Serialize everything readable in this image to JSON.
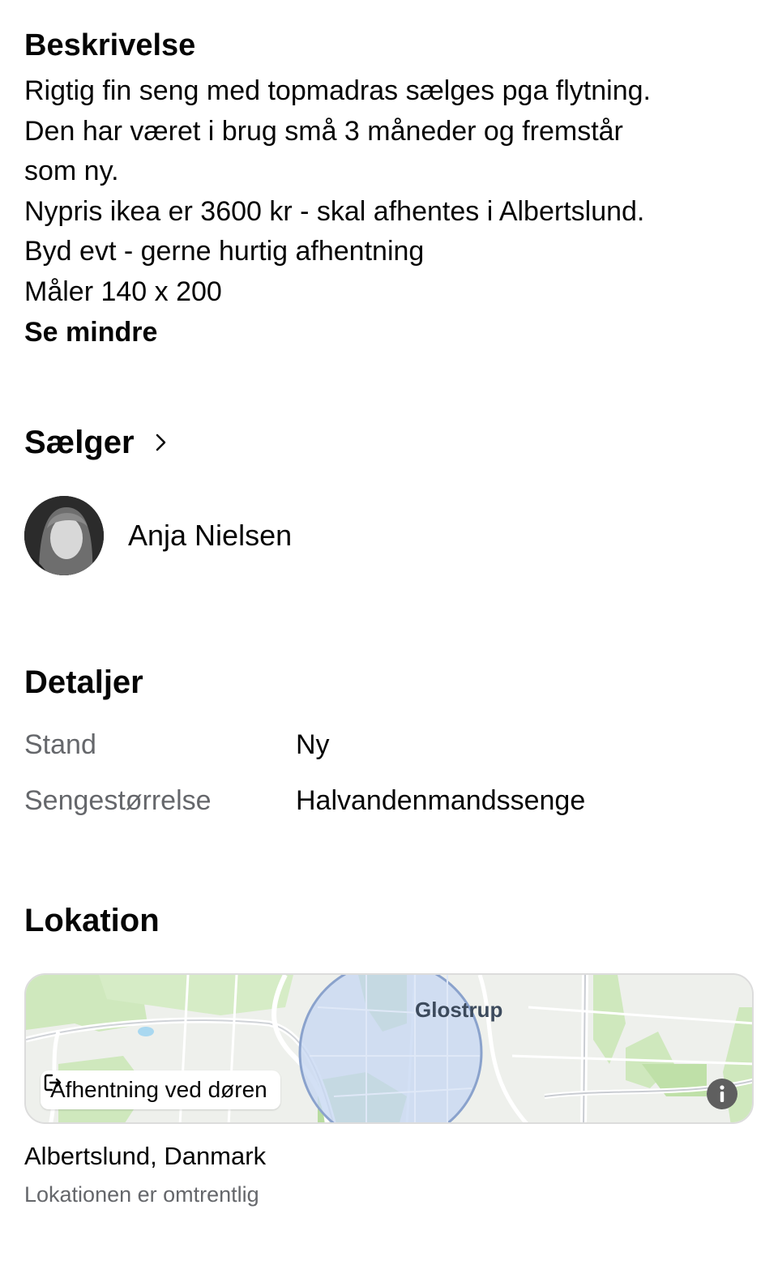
{
  "description": {
    "title": "Beskrivelse",
    "lines": [
      "Rigtig fin seng med topmadras sælges pga flytning.",
      "Den har været i brug små 3 måneder og fremstår",
      "som ny.",
      "Nypris ikea er 3600 kr - skal afhentes i Albertslund.",
      "Byd evt - gerne hurtig afhentning",
      "Måler 140 x 200"
    ],
    "see_less": "Se mindre"
  },
  "seller": {
    "title": "Sælger",
    "chevron_icon": "chevron-right-icon",
    "name": "Anja Nielsen",
    "avatar_icon": "profile-photo"
  },
  "details": {
    "title": "Detaljer",
    "rows": [
      {
        "key": "Stand",
        "value": "Ny"
      },
      {
        "key": "Sengestørrelse",
        "value": "Halvandenmandssenge"
      }
    ]
  },
  "location": {
    "title": "Lokation",
    "map_label": "Glostrup",
    "pickup_chip": "Afhentning ved døren",
    "pickup_icon": "door-exit-icon",
    "info_icon": "info-icon",
    "place": "Albertslund, Danmark",
    "note": "Lokationen er omtrentlig",
    "colors": {
      "park": "#c9e6b4",
      "water": "#a9d8f0",
      "radius_fill": "#c8d8f2",
      "radius_stroke": "#8aa2cc",
      "road": "#ffffff"
    }
  }
}
